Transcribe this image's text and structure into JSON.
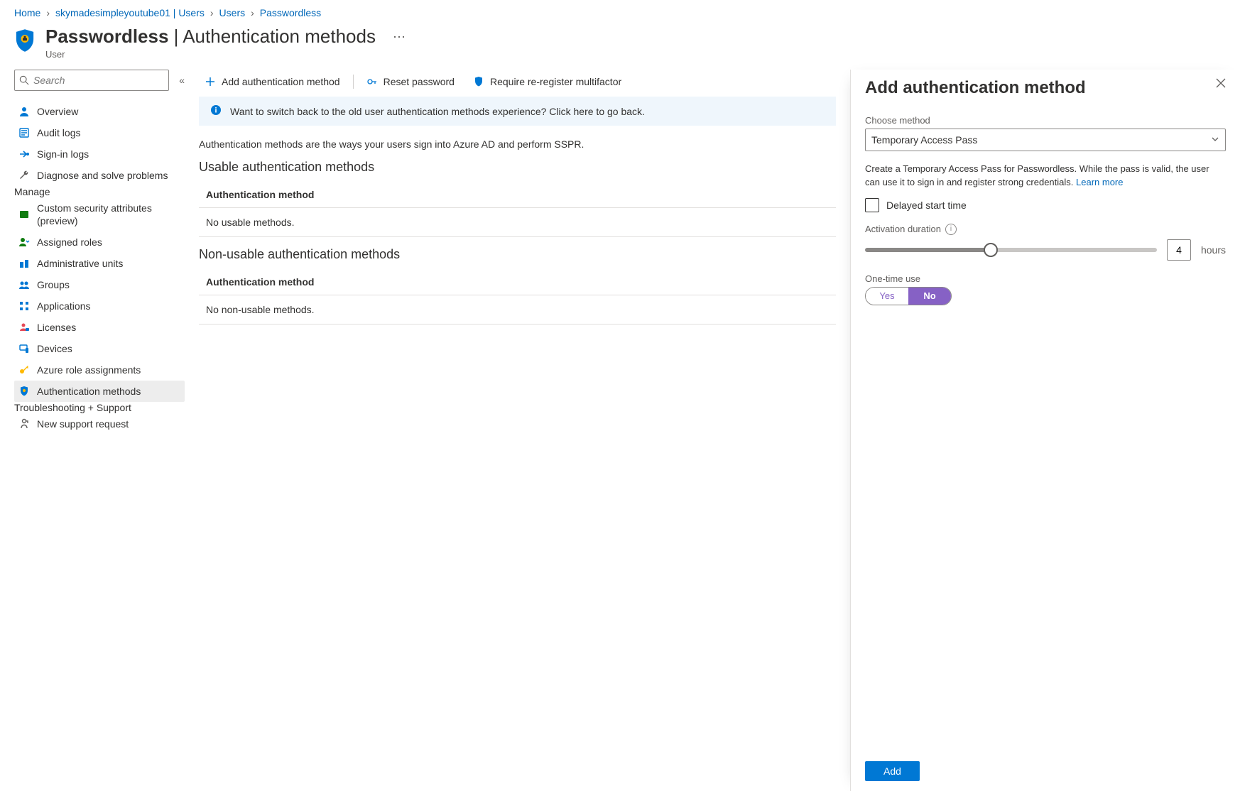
{
  "breadcrumb": {
    "items": [
      "Home",
      "skymadesimpleyoutube01 | Users",
      "Users",
      "Passwordless"
    ]
  },
  "header": {
    "title_main": "Passwordless",
    "title_sep": " | ",
    "title_sub": "Authentication methods",
    "subtitle": "User"
  },
  "search": {
    "placeholder": "Search"
  },
  "sidebar": {
    "items_top": [
      {
        "label": "Overview",
        "icon": "person-icon",
        "color": "#0078d4"
      },
      {
        "label": "Audit logs",
        "icon": "log-icon",
        "color": "#0078d4"
      },
      {
        "label": "Sign-in logs",
        "icon": "signin-icon",
        "color": "#0078d4"
      },
      {
        "label": "Diagnose and solve problems",
        "icon": "wrench-icon",
        "color": "#605e5c"
      }
    ],
    "section_manage": "Manage",
    "items_manage": [
      {
        "label": "Custom security attributes (preview)",
        "icon": "attr-icon",
        "color": "#107c10",
        "wrap": true
      },
      {
        "label": "Assigned roles",
        "icon": "roles-icon",
        "color": "#107c10"
      },
      {
        "label": "Administrative units",
        "icon": "adminunits-icon",
        "color": "#0078d4"
      },
      {
        "label": "Groups",
        "icon": "groups-icon",
        "color": "#0078d4"
      },
      {
        "label": "Applications",
        "icon": "apps-icon",
        "color": "#0078d4"
      },
      {
        "label": "Licenses",
        "icon": "licenses-icon",
        "color": "#e74856"
      },
      {
        "label": "Devices",
        "icon": "devices-icon",
        "color": "#0078d4"
      },
      {
        "label": "Azure role assignments",
        "icon": "key-icon",
        "color": "#ffb900"
      },
      {
        "label": "Authentication methods",
        "icon": "shield-icon",
        "color": "#0078d4",
        "selected": true
      }
    ],
    "section_trouble": "Troubleshooting + Support",
    "items_trouble": [
      {
        "label": "New support request",
        "icon": "support-icon",
        "color": "#605e5c"
      }
    ]
  },
  "toolbar": {
    "add_label": "Add authentication method",
    "reset_label": "Reset password",
    "require_label": "Require re-register multifactor"
  },
  "infobar": {
    "text": "Want to switch back to the old user authentication methods experience? Click here to go back."
  },
  "intro": "Authentication methods are the ways your users sign into Azure AD and perform SSPR.",
  "usable": {
    "title": "Usable authentication methods",
    "col": "Authentication method",
    "empty": "No usable methods."
  },
  "nonusable": {
    "title": "Non-usable authentication methods",
    "col": "Authentication method",
    "empty": "No non-usable methods."
  },
  "panel": {
    "title": "Add authentication method",
    "choose_label": "Choose method",
    "choose_value": "Temporary Access Pass",
    "desc_1": "Create a Temporary Access Pass for Passwordless. While the pass is valid, the user can use it to sign in and register strong credentials. ",
    "learn_more": "Learn more",
    "delayed_label": "Delayed start time",
    "activation_label": "Activation duration",
    "activation_value": "4",
    "activation_unit": "hours",
    "onetime_label": "One-time use",
    "onetime_yes": "Yes",
    "onetime_no": "No",
    "add_btn": "Add"
  }
}
